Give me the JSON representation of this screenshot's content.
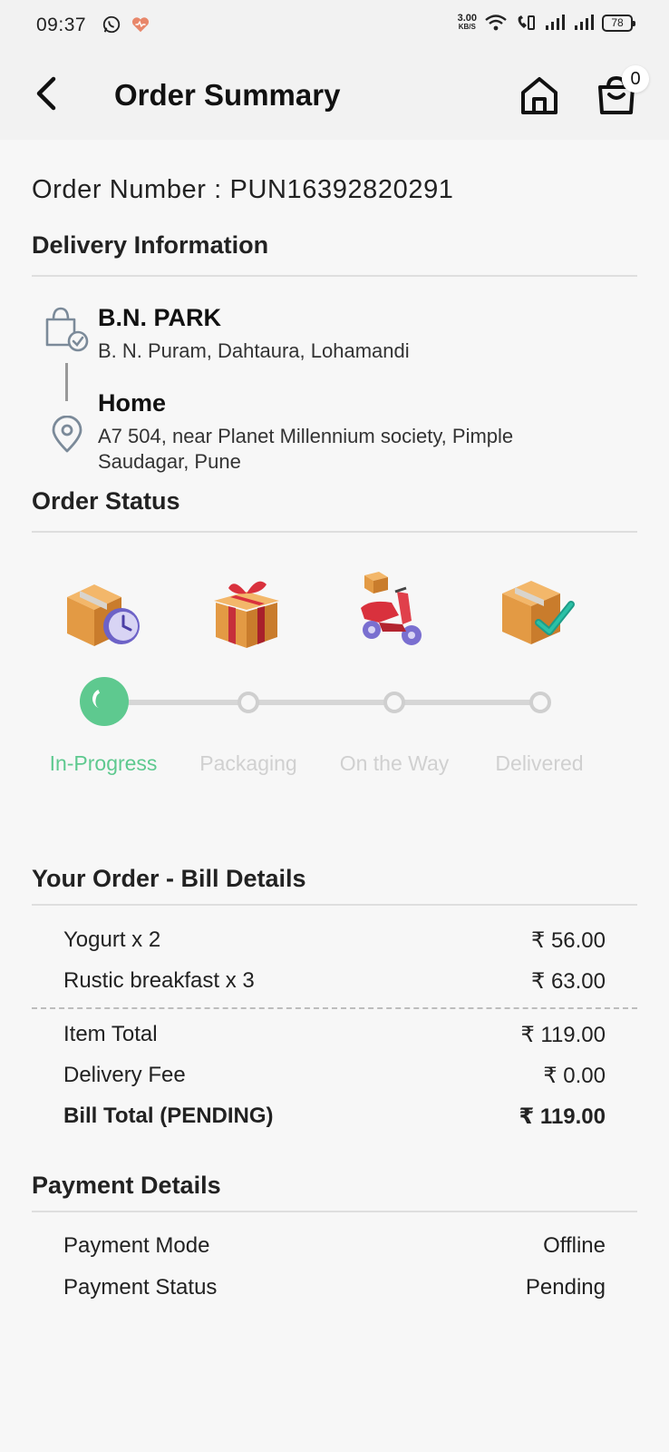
{
  "status_bar": {
    "time": "09:37",
    "speed_value": "3.00",
    "speed_unit": "KB/S",
    "battery": "78"
  },
  "header": {
    "title": "Order Summary",
    "cart_count": "0"
  },
  "order": {
    "number_text": "Order Number : PUN16392820291"
  },
  "delivery": {
    "title": "Delivery Information",
    "pickup_name": "B.N. PARK",
    "pickup_address": "B. N. Puram, Dahtaura, Lohamandi",
    "drop_name": "Home",
    "drop_address": "A7 504, near Planet Millennium society, Pimple Saudagar, Pune"
  },
  "order_status": {
    "title": "Order Status",
    "steps": [
      {
        "label": "In-Progress",
        "active": true
      },
      {
        "label": "Packaging",
        "active": false
      },
      {
        "label": "On the Way",
        "active": false
      },
      {
        "label": "Delivered",
        "active": false
      }
    ]
  },
  "bill": {
    "title": "Your Order - Bill Details",
    "items": [
      {
        "name": "Yogurt x 2",
        "price": "₹ 56.00"
      },
      {
        "name": "Rustic breakfast x 3",
        "price": "₹ 63.00"
      }
    ],
    "item_total_label": "Item Total",
    "item_total_value": "₹ 119.00",
    "delivery_fee_label": "Delivery Fee",
    "delivery_fee_value": "₹ 0.00",
    "bill_total_label": "Bill Total (PENDING)",
    "bill_total_value": "₹ 119.00"
  },
  "payment": {
    "title": "Payment Details",
    "mode_label": "Payment Mode",
    "mode_value": "Offline",
    "status_label": "Payment Status",
    "status_value": "Pending"
  },
  "colors": {
    "accent_green": "#5ec98f",
    "inactive_grey": "#d0d0d0"
  }
}
